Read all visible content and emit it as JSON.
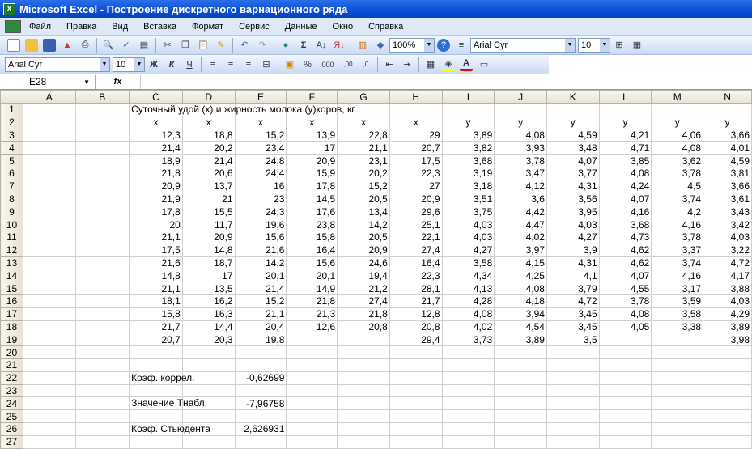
{
  "window": {
    "title": "Microsoft Excel - Построение дискретного варнационного ряда"
  },
  "menu": [
    "Файл",
    "Правка",
    "Вид",
    "Вставка",
    "Формат",
    "Сервис",
    "Данные",
    "Окно",
    "Справка"
  ],
  "toolbar": {
    "zoom": "100%",
    "font": "Arial Cyr",
    "size": "10",
    "font2": "Arial Cyr",
    "size2": "10",
    "bold": "Ж",
    "italic": "К",
    "underline": "Ч",
    "percent": "%",
    "thousands": "000"
  },
  "formula_bar": {
    "name_box": "E28",
    "fx": "fx",
    "value": ""
  },
  "columns": [
    "A",
    "B",
    "C",
    "D",
    "E",
    "F",
    "G",
    "H",
    "I",
    "J",
    "K",
    "L",
    "M",
    "N"
  ],
  "selected_column": "E",
  "title_cell": "Суточный удой (х) и жирность молока (у)коров, кг",
  "headers": [
    "x",
    "x",
    "x",
    "x",
    "x",
    "x",
    "y",
    "y",
    "y",
    "y",
    "y",
    "y"
  ],
  "data": [
    [
      "12,3",
      "18,8",
      "15,2",
      "13,9",
      "22,8",
      "29",
      "3,89",
      "4,08",
      "4,59",
      "4,21",
      "4,06",
      "3,66"
    ],
    [
      "21,4",
      "20,2",
      "23,4",
      "17",
      "21,1",
      "20,7",
      "3,82",
      "3,93",
      "3,48",
      "4,71",
      "4,08",
      "4,01"
    ],
    [
      "18,9",
      "21,4",
      "24,8",
      "20,9",
      "23,1",
      "17,5",
      "3,68",
      "3,78",
      "4,07",
      "3,85",
      "3,62",
      "4,59"
    ],
    [
      "21,8",
      "20,6",
      "24,4",
      "15,9",
      "20,2",
      "22,3",
      "3,19",
      "3,47",
      "3,77",
      "4,08",
      "3,78",
      "3,81"
    ],
    [
      "20,9",
      "13,7",
      "16",
      "17,8",
      "15,2",
      "27",
      "3,18",
      "4,12",
      "4,31",
      "4,24",
      "4,5",
      "3,66"
    ],
    [
      "21,9",
      "21",
      "23",
      "14,5",
      "20,5",
      "20,9",
      "3,51",
      "3,6",
      "3,56",
      "4,07",
      "3,74",
      "3,61"
    ],
    [
      "17,8",
      "15,5",
      "24,3",
      "17,6",
      "13,4",
      "29,6",
      "3,75",
      "4,42",
      "3,95",
      "4,16",
      "4,2",
      "3,43"
    ],
    [
      "20",
      "11,7",
      "19,6",
      "23,8",
      "14,2",
      "25,1",
      "4,03",
      "4,47",
      "4,03",
      "3,68",
      "4,16",
      "3,42"
    ],
    [
      "21,1",
      "20,9",
      "15,6",
      "15,8",
      "20,5",
      "22,1",
      "4,03",
      "4,02",
      "4,27",
      "4,73",
      "3,78",
      "4,03"
    ],
    [
      "17,5",
      "14,8",
      "21,6",
      "16,4",
      "20,9",
      "27,4",
      "4,27",
      "3,97",
      "3,9",
      "4,62",
      "3,37",
      "3,22"
    ],
    [
      "21,6",
      "18,7",
      "14,2",
      "15,6",
      "24,6",
      "16,4",
      "3,58",
      "4,15",
      "4,31",
      "4,62",
      "3,74",
      "4,72"
    ],
    [
      "14,8",
      "17",
      "20,1",
      "20,1",
      "19,4",
      "22,3",
      "4,34",
      "4,25",
      "4,1",
      "4,07",
      "4,16",
      "4,17"
    ],
    [
      "21,1",
      "13,5",
      "21,4",
      "14,9",
      "21,2",
      "28,1",
      "4,13",
      "4,08",
      "3,79",
      "4,55",
      "3,17",
      "3,88"
    ],
    [
      "18,1",
      "16,2",
      "15,2",
      "21,8",
      "27,4",
      "21,7",
      "4,28",
      "4,18",
      "4,72",
      "3,78",
      "3,59",
      "4,03"
    ],
    [
      "15,8",
      "16,3",
      "21,1",
      "21,3",
      "21,8",
      "12,8",
      "4,08",
      "3,94",
      "3,45",
      "4,08",
      "3,58",
      "4,29"
    ],
    [
      "21,7",
      "14,4",
      "20,4",
      "12,6",
      "20,8",
      "20,8",
      "4,02",
      "4,54",
      "3,45",
      "4,05",
      "3,38",
      "3,89"
    ],
    [
      "20,7",
      "20,3",
      "19,8",
      "",
      "",
      "29,4",
      "3,73",
      "3,89",
      "3,5",
      "",
      "",
      "3,98"
    ]
  ],
  "stats": [
    {
      "row": 22,
      "label": "Коэф. коррел.",
      "value": "-0,62699"
    },
    {
      "row": 24,
      "label": "Значение Тнабл.",
      "value": "-7,96758"
    },
    {
      "row": 26,
      "label": "Коэф. Стьюдента",
      "value": "2,626931"
    }
  ]
}
